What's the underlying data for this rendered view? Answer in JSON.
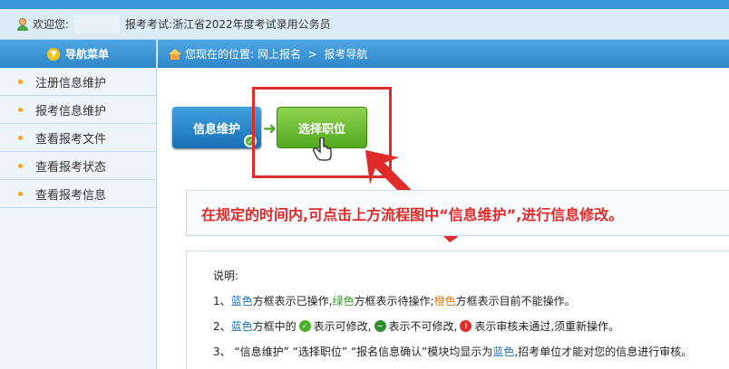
{
  "header": {
    "welcome_label": "欢迎您:",
    "exam_label": "报考考试:",
    "exam_name": "浙江省2022年度考试录用公务员"
  },
  "sidebar": {
    "title": "导航菜单",
    "items": [
      {
        "label": "注册信息维护"
      },
      {
        "label": "报考信息维护"
      },
      {
        "label": "查看报考文件"
      },
      {
        "label": "查看报考状态"
      },
      {
        "label": "查看报考信息"
      }
    ]
  },
  "breadcrumb": {
    "prefix": "您现在的位置:",
    "path": "网上报名  >  报考导航"
  },
  "flow": {
    "step1_label": "信息维护",
    "step2_label": "选择职位"
  },
  "notice": {
    "text": "在规定的时间内,可点击上方流程图中“信息维护”,进行信息修改。"
  },
  "explain": {
    "title": "说明:",
    "line1": {
      "p1": "1、",
      "blue": "蓝色",
      "p2": "方框表示已操作, ",
      "green": "绿色",
      "p3": "方框表示待操作;",
      "orange": "橙色",
      "p4": "方框表示目前不能操作。"
    },
    "line2": {
      "p1": "2、",
      "blue": "蓝色",
      "p2": "方框中的",
      "p3": "表示可修改,",
      "p4": "表示不可修改,",
      "p5": "表示审核未通过,须重新操作。"
    },
    "line3": {
      "p1": "3、 “信息维护” “选择职位” “报名信息确认”模块均显示为",
      "blue": "蓝色",
      "p2": ",招考单位才能对您的信息进行审核。"
    }
  },
  "colors": {
    "accent_blue": "#2f86c9",
    "highlight_red": "#e02b2b",
    "action_green": "#52a81f"
  }
}
